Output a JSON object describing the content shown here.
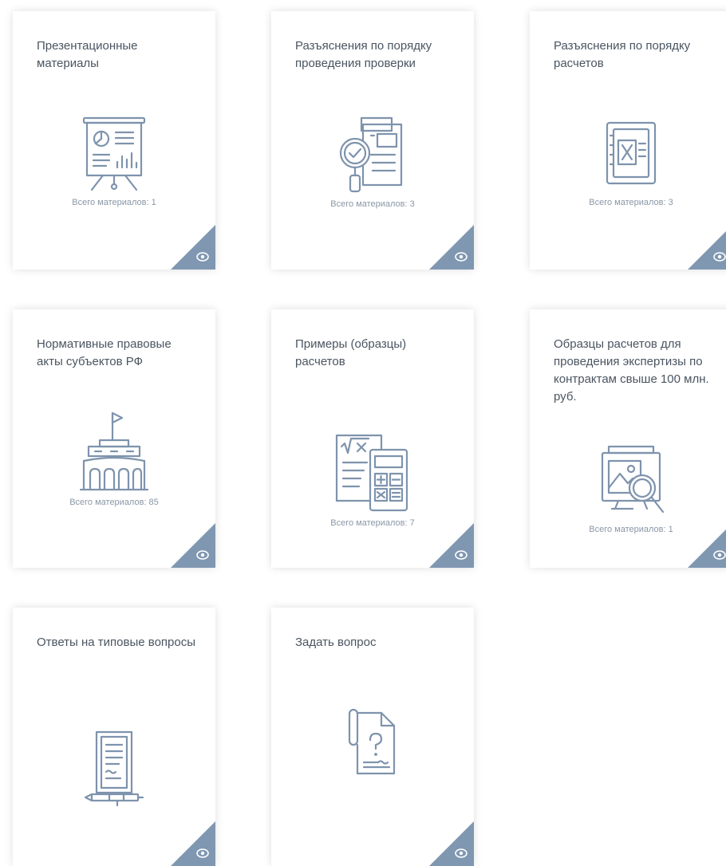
{
  "cards": [
    {
      "title": "Презентационные материалы",
      "count": "Всего материалов: 1"
    },
    {
      "title": "Разъяснения по порядку проведения проверки",
      "count": "Всего материалов: 3"
    },
    {
      "title": "Разъяснения по порядку расчетов",
      "count": "Всего материалов: 3"
    },
    {
      "title": "Нормативные правовые акты субъектов РФ",
      "count": "Всего материалов: 85"
    },
    {
      "title": "Примеры (образцы) расчетов",
      "count": "Всего материалов: 7"
    },
    {
      "title": "Образцы расчетов для проведения экспертизы по контрактам свыше 100 млн. руб.",
      "count": "Всего материалов: 1"
    },
    {
      "title": "Ответы на типовые вопросы"
    },
    {
      "title": "Задать вопрос"
    }
  ],
  "icons": {
    "card_0": "presentation-board-icon",
    "card_1": "document-magnifier-check-icon",
    "card_2": "excel-file-icon",
    "card_3": "government-building-flag-icon",
    "card_4": "formula-calculator-icon",
    "card_5": "image-magnifier-icon",
    "card_6": "document-pen-icon",
    "card_7": "question-scroll-icon",
    "corner": "eye-icon"
  },
  "colors": {
    "icon_stroke": "#7e93ad",
    "corner_fill": "#7f97b1",
    "title_text": "#4a5561",
    "count_text": "#8a97a6"
  }
}
